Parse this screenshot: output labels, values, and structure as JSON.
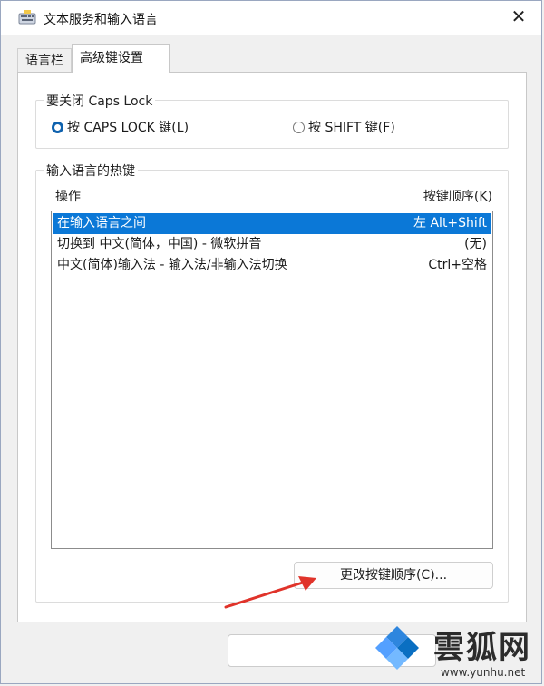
{
  "window": {
    "title": "文本服务和输入语言",
    "close_glyph": "✕"
  },
  "tabs": [
    {
      "label": "语言栏",
      "active": false
    },
    {
      "label": "高级键设置",
      "active": true
    }
  ],
  "caps_group": {
    "legend": "要关闭 Caps Lock",
    "options": [
      {
        "label": "按 CAPS LOCK 键(L)",
        "selected": true
      },
      {
        "label": "按 SHIFT 键(F)",
        "selected": false
      }
    ]
  },
  "hotkeys_group": {
    "legend": "输入语言的热键",
    "col_action": "操作",
    "col_keys": "按键顺序(K)",
    "rows": [
      {
        "action": "在输入语言之间",
        "keys": "左 Alt+Shift",
        "selected": true
      },
      {
        "action": "切换到 中文(简体，中国) - 微软拼音",
        "keys": "(无)",
        "selected": false
      },
      {
        "action": "中文(简体)输入法 - 输入法/非输入法切换",
        "keys": "Ctrl+空格",
        "selected": false
      }
    ],
    "change_button": "更改按键顺序(C)..."
  },
  "watermark": {
    "name": "雲狐网",
    "url": "www.yunhu.net"
  },
  "colors": {
    "selection": "#0b78d7",
    "radio_accent": "#0f62ae",
    "arrow": "#e0332a"
  }
}
